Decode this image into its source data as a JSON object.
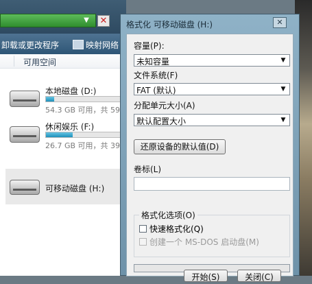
{
  "explorer": {
    "toolbar": {
      "uninstall_label": "卸载或更改程序",
      "map_label": "映射网络"
    },
    "column": {
      "free_space": "可用空间"
    },
    "drives": [
      {
        "name": "本地磁盘 (D:)",
        "info": "54.3 GB 可用，共 59.",
        "used_percent": 10
      },
      {
        "name": "休闲娱乐 (F:)",
        "info": "26.7 GB 可用，共 39.",
        "used_percent": 34
      },
      {
        "name": "可移动磁盘 (H:)"
      }
    ],
    "close_glyph": "✕"
  },
  "dialog": {
    "title": "格式化 可移动磁盘 (H:)",
    "close_glyph": "✕",
    "capacity": {
      "label": "容量(P):",
      "value": "未知容量"
    },
    "filesystem": {
      "label": "文件系统(F)",
      "value": "FAT (默认)"
    },
    "alloc": {
      "label": "分配单元大小(A)",
      "value": "默认配置大小"
    },
    "restore_button": "还原设备的默认值(D)",
    "volume": {
      "label": "卷标(L)",
      "value": ""
    },
    "options": {
      "title": "格式化选项(O)",
      "quick_format": "快速格式化(Q)",
      "msdos_boot": "创建一个 MS-DOS 启动盘(M)"
    },
    "start_button": "开始(S)",
    "close_button": "关闭(C)"
  },
  "icons": {
    "dropdown": "chevron-down-icon",
    "disk": "hard-disk-icon"
  }
}
